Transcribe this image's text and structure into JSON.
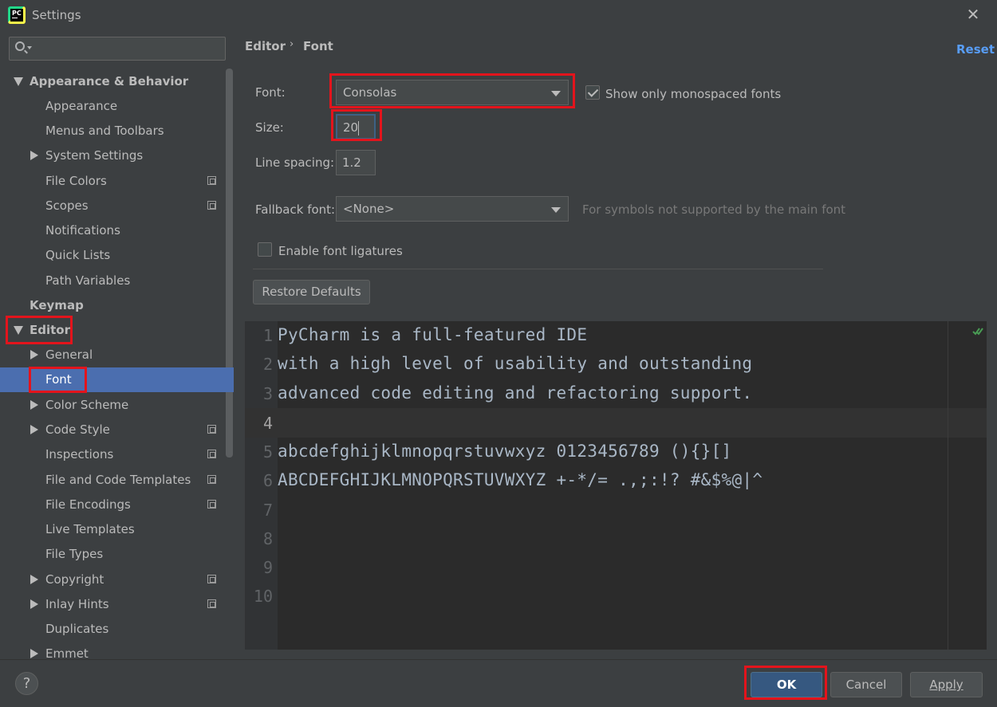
{
  "window": {
    "title": "Settings",
    "close_label": "✕"
  },
  "search": {
    "placeholder": ""
  },
  "sidebar": {
    "items": [
      {
        "label": "Appearance & Behavior"
      },
      {
        "label": "Appearance"
      },
      {
        "label": "Menus and Toolbars"
      },
      {
        "label": "System Settings"
      },
      {
        "label": "File Colors"
      },
      {
        "label": "Scopes"
      },
      {
        "label": "Notifications"
      },
      {
        "label": "Quick Lists"
      },
      {
        "label": "Path Variables"
      },
      {
        "label": "Keymap"
      },
      {
        "label": "Editor"
      },
      {
        "label": "General"
      },
      {
        "label": "Font"
      },
      {
        "label": "Color Scheme"
      },
      {
        "label": "Code Style"
      },
      {
        "label": "Inspections"
      },
      {
        "label": "File and Code Templates"
      },
      {
        "label": "File Encodings"
      },
      {
        "label": "Live Templates"
      },
      {
        "label": "File Types"
      },
      {
        "label": "Copyright"
      },
      {
        "label": "Inlay Hints"
      },
      {
        "label": "Duplicates"
      },
      {
        "label": "Emmet"
      }
    ]
  },
  "breadcrumb": {
    "parent": "Editor",
    "separator": "›",
    "current": "Font"
  },
  "reset_label": "Reset",
  "form": {
    "font_label": "Font:",
    "font_value": "Consolas",
    "mono_label": "Show only monospaced fonts",
    "mono_checked": true,
    "size_label": "Size:",
    "size_value": "20",
    "spacing_label": "Line spacing:",
    "spacing_value": "1.2",
    "fallback_label": "Fallback font:",
    "fallback_value": "<None>",
    "fallback_hint": "For symbols not supported by the main font",
    "ligatures_label": "Enable font ligatures",
    "ligatures_checked": false,
    "restore_label": "Restore Defaults"
  },
  "preview": {
    "line_numbers": [
      "1",
      "2",
      "3",
      "4",
      "5",
      "6",
      "7",
      "8",
      "9",
      "10"
    ],
    "lines": [
      "PyCharm is a full-featured IDE",
      "with a high level of usability and outstanding",
      "advanced code editing and refactoring support.",
      "",
      "abcdefghijklmnopqrstuvwxyz 0123456789 (){}[]",
      "ABCDEFGHIJKLMNOPQRSTUVWXYZ +-*/= .,;:!? #&$%@|^"
    ]
  },
  "buttons": {
    "help": "?",
    "ok": "OK",
    "cancel": "Cancel",
    "apply": "Apply"
  },
  "colors": {
    "highlight": "#e3141c",
    "selection": "#4b6eaf",
    "link": "#589df6",
    "ok_button": "#365880"
  }
}
